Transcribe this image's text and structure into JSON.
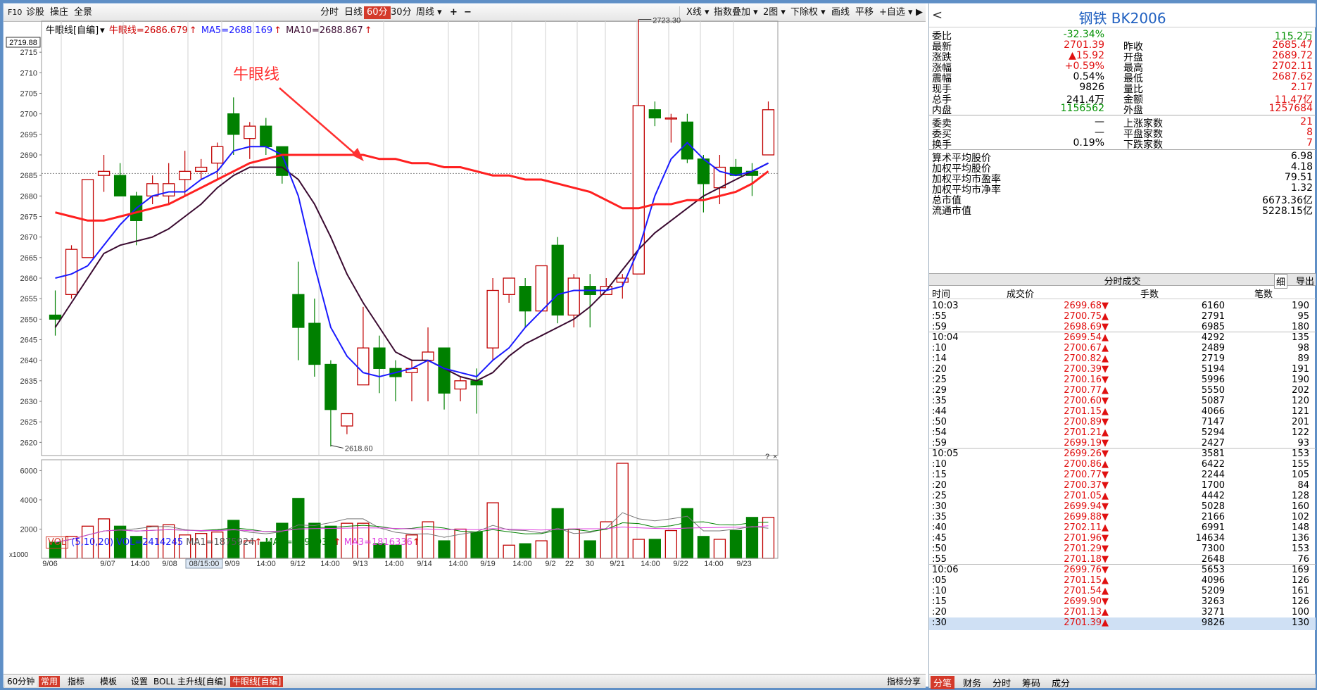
{
  "toolbar": {
    "f10": "F10",
    "diagnose": "诊股",
    "ops": "操庄",
    "full": "全景",
    "timeshare": "分时",
    "daily": "日线",
    "min60": "60分",
    "min30": "30分",
    "weekly": "周线 ▾",
    "plus": "+",
    "minus": "−",
    "xline": "X线 ▾",
    "index_overlay": "指数叠加 ▾",
    "two_chart": "2图 ▾",
    "ex_right": "下除权 ▾",
    "draw": "画线",
    "pan": "平移",
    "add_fav": "+自选 ▾",
    "next": "▶"
  },
  "info": {
    "indicator": "牛眼线[自编]",
    "mark": "▾",
    "neuyan": "牛眼线=2686.679",
    "ma5": "MA5=2688.169",
    "ma10": "MA10=2688.867",
    "arrow": "↑"
  },
  "price_axis": {
    "top_label": "2719.88",
    "ticks": [
      "2715",
      "2710",
      "2705",
      "2700",
      "2695",
      "2690",
      "2685",
      "2680",
      "2675",
      "2670",
      "2665",
      "2660",
      "2655",
      "2650",
      "2645",
      "2640",
      "2635",
      "2630",
      "2625",
      "2620"
    ]
  },
  "annotations": {
    "high": "2723.30",
    "low": "2618.60",
    "callout": "牛眼线"
  },
  "vol": {
    "name": "VOL",
    "params": "(5,10,20)",
    "vol": "VOL=2414245",
    "ma1": "MA1=1875924",
    "ma2": "MA2=2093937",
    "ma3": "MA3=1816336",
    "axis": [
      "6000",
      "4000",
      "2000"
    ],
    "unit": "x1000"
  },
  "time_labels": [
    "9/06",
    "9/07",
    "14:00",
    "9/08",
    "08/15:00",
    "9/09",
    "14:00",
    "9/12",
    "14:00",
    "9/13",
    "14:00",
    "9/14",
    "14:00",
    "9/19",
    "14:00",
    "9/2",
    "22",
    "30",
    "9/21",
    "14:00",
    "9/22",
    "14:00",
    "9/23"
  ],
  "bottom": {
    "period": "60分钟",
    "mode": "常用",
    "indicators": "指标",
    "templates": "模板",
    "settings": "设置",
    "boll": "BOLL",
    "main_up": "主升线[自编]",
    "niu": "牛眼线[自编]",
    "ind_share": "指标分享"
  },
  "colors": {
    "up": "#c00000",
    "down": "#008000",
    "neuyan": "#ff2020",
    "ma5": "#1a1aff",
    "ma10": "#3a0a30"
  },
  "chart_data": {
    "type": "candlestick",
    "ylim": [
      2618,
      2720
    ],
    "candles": [
      [
        2651,
        2657,
        2646,
        2650
      ],
      [
        2656,
        2668,
        2655,
        2667
      ],
      [
        2665,
        2684,
        2665,
        2684
      ],
      [
        2685,
        2690,
        2681,
        2686
      ],
      [
        2685,
        2688,
        2680,
        2680
      ],
      [
        2680,
        2681,
        2668,
        2674
      ],
      [
        2680,
        2685,
        2678,
        2683
      ],
      [
        2680,
        2688,
        2678,
        2683
      ],
      [
        2684,
        2691,
        2680,
        2686
      ],
      [
        2686,
        2689,
        2684,
        2687
      ],
      [
        2688,
        2693,
        2684,
        2692
      ],
      [
        2700,
        2704,
        2690,
        2695
      ],
      [
        2694,
        2698,
        2689,
        2697
      ],
      [
        2697,
        2699,
        2690,
        2692
      ],
      [
        2692,
        2692,
        2683,
        2685
      ],
      [
        2656,
        2664,
        2640,
        2648
      ],
      [
        2649,
        2655,
        2636,
        2639
      ],
      [
        2639,
        2640,
        2619,
        2628
      ],
      [
        2624,
        2627,
        2622,
        2627
      ],
      [
        2634,
        2653,
        2634,
        2643
      ],
      [
        2643,
        2646,
        2632,
        2638
      ],
      [
        2638,
        2640,
        2630,
        2636
      ],
      [
        2637,
        2640,
        2630,
        2638
      ],
      [
        2640,
        2648,
        2630,
        2642
      ],
      [
        2643,
        2643,
        2628,
        2632
      ],
      [
        2633,
        2636,
        2630,
        2635
      ],
      [
        2635,
        2638,
        2627,
        2634
      ],
      [
        2643,
        2660,
        2640,
        2657
      ],
      [
        2656,
        2660,
        2654,
        2660
      ],
      [
        2658,
        2660,
        2648,
        2652
      ],
      [
        2652,
        2663,
        2652,
        2663
      ],
      [
        2668,
        2670,
        2649,
        2651
      ],
      [
        2651,
        2661,
        2648,
        2660
      ],
      [
        2658,
        2661,
        2648,
        2656
      ],
      [
        2656,
        2660,
        2656,
        2658
      ],
      [
        2659,
        2661,
        2655,
        2660
      ],
      [
        2661,
        2723,
        2661,
        2702
      ],
      [
        2701,
        2703,
        2697,
        2699
      ],
      [
        2699,
        2700,
        2693,
        2699
      ],
      [
        2698,
        2700,
        2688,
        2689
      ],
      [
        2689,
        2690,
        2676,
        2683
      ],
      [
        2682,
        2690,
        2678,
        2687
      ],
      [
        2687,
        2689,
        2686,
        2685
      ],
      [
        2686,
        2688,
        2680,
        2685
      ],
      [
        2690,
        2703,
        2690,
        2701
      ]
    ],
    "neuyan": [
      2676,
      2675,
      2674,
      2674,
      2675,
      2676,
      2677,
      2678,
      2680,
      2682,
      2684,
      2686,
      2688,
      2689,
      2690,
      2690,
      2690,
      2690,
      2690,
      2690,
      2689,
      2689,
      2688,
      2688,
      2687,
      2687,
      2686,
      2685,
      2685,
      2684,
      2684,
      2683,
      2682,
      2681,
      2679,
      2677,
      2677,
      2678,
      2678,
      2679,
      2679,
      2680,
      2681,
      2683,
      2686
    ],
    "ma5": [
      2660,
      2661,
      2663,
      2668,
      2673,
      2677,
      2680,
      2681,
      2681,
      2684,
      2686,
      2691,
      2692,
      2692,
      2690,
      2680,
      2663,
      2648,
      2641,
      2637,
      2636,
      2637,
      2638,
      2640,
      2638,
      2637,
      2636,
      2640,
      2643,
      2648,
      2652,
      2656,
      2657,
      2657,
      2657,
      2658,
      2667,
      2680,
      2689,
      2693,
      2689,
      2686,
      2685,
      2686,
      2688
    ],
    "ma10": [
      2648,
      2654,
      2660,
      2666,
      2668,
      2669,
      2670,
      2672,
      2675,
      2678,
      2682,
      2685,
      2687,
      2687,
      2687,
      2684,
      2678,
      2670,
      2661,
      2654,
      2648,
      2642,
      2640,
      2640,
      2638,
      2636,
      2635,
      2637,
      2641,
      2644,
      2646,
      2648,
      2650,
      2653,
      2657,
      2662,
      2667,
      2671,
      2674,
      2677,
      2680,
      2682,
      2684,
      2686,
      2688
    ],
    "volume": [
      1100,
      1500,
      2200,
      2700,
      2200,
      1500,
      2200,
      2300,
      1600,
      1700,
      1800,
      2600,
      1200,
      1100,
      2400,
      4100,
      2400,
      2200,
      2400,
      2400,
      1000,
      900,
      1600,
      2500,
      1200,
      2000,
      1800,
      3800,
      900,
      1000,
      1200,
      3400,
      2000,
      1200,
      2500,
      6500,
      1300,
      1300,
      1900,
      3400,
      1500,
      1300,
      1900,
      2800,
      2800
    ]
  },
  "panel": {
    "title": "钢铁  BK2006",
    "back": "<",
    "rows": [
      [
        "委比",
        "-32.34%",
        "",
        "115.2万"
      ],
      [
        "最新",
        "2701.39",
        "昨收",
        "2685.47"
      ],
      [
        "涨跌",
        "▲15.92",
        "开盘",
        "2689.72"
      ],
      [
        "涨幅",
        "+0.59%",
        "最高",
        "2702.11"
      ],
      [
        "震幅",
        "0.54%",
        "最低",
        "2687.62"
      ],
      [
        "现手",
        "9826",
        "量比",
        "2.17"
      ],
      [
        "总手",
        "241.4万",
        "金额",
        "11.47亿"
      ],
      [
        "内盘",
        "1156562",
        "外盘",
        "1257684"
      ],
      [
        "委卖",
        "—",
        "上涨家数",
        "21"
      ],
      [
        "委买",
        "—",
        "平盘家数",
        "8"
      ],
      [
        "换手",
        "0.19%",
        "下跌家数",
        "7"
      ]
    ],
    "stats": [
      [
        "算术平均股价",
        "6.98"
      ],
      [
        "加权平均股价",
        "4.18"
      ],
      [
        "加权平均市盈率",
        "79.51"
      ],
      [
        "加权平均市净率",
        "1.32"
      ],
      [
        "总市值",
        "6673.36亿"
      ],
      [
        "流通市值",
        "5228.15亿"
      ]
    ],
    "trade_title": "分时成交",
    "fine": "细",
    "export": "导出",
    "cols": [
      "时间",
      "成交价",
      "手数",
      "笔数"
    ],
    "trades": [
      [
        "10:03",
        "2699.68▼",
        "6160",
        "190"
      ],
      [
        ":55",
        "2700.75▲",
        "2791",
        "95"
      ],
      [
        ":59",
        "2698.69▼",
        "6985",
        "180"
      ],
      [
        "10:04",
        "2699.54▲",
        "4292",
        "135"
      ],
      [
        ":10",
        "2700.67▲",
        "2489",
        "98"
      ],
      [
        ":14",
        "2700.82▲",
        "2719",
        "89"
      ],
      [
        ":20",
        "2700.39▼",
        "5194",
        "191"
      ],
      [
        ":25",
        "2700.16▼",
        "5996",
        "190"
      ],
      [
        ":29",
        "2700.77▲",
        "5550",
        "202"
      ],
      [
        ":35",
        "2700.60▼",
        "5087",
        "120"
      ],
      [
        ":44",
        "2701.15▲",
        "4066",
        "121"
      ],
      [
        ":50",
        "2700.89▼",
        "7147",
        "201"
      ],
      [
        ":54",
        "2701.21▲",
        "5294",
        "122"
      ],
      [
        ":59",
        "2699.19▼",
        "2427",
        "93"
      ],
      [
        "10:05",
        "2699.26▼",
        "3581",
        "153"
      ],
      [
        ":10",
        "2700.86▲",
        "6422",
        "155"
      ],
      [
        ":15",
        "2700.77▼",
        "2244",
        "105"
      ],
      [
        ":20",
        "2700.37▼",
        "1700",
        "84"
      ],
      [
        ":25",
        "2701.05▲",
        "4442",
        "128"
      ],
      [
        ":30",
        "2699.94▼",
        "5028",
        "160"
      ],
      [
        ":35",
        "2699.88▼",
        "2166",
        "102"
      ],
      [
        ":40",
        "2702.11▲",
        "6991",
        "148"
      ],
      [
        ":45",
        "2701.96▼",
        "14634",
        "136"
      ],
      [
        ":50",
        "2701.29▼",
        "7300",
        "153"
      ],
      [
        ":55",
        "2701.18▼",
        "2648",
        "76"
      ],
      [
        "10:06",
        "2699.76▼",
        "5653",
        "169"
      ],
      [
        ":05",
        "2701.15▲",
        "4096",
        "126"
      ],
      [
        ":10",
        "2701.54▲",
        "5209",
        "161"
      ],
      [
        ":15",
        "2699.90▼",
        "3263",
        "126"
      ],
      [
        ":20",
        "2701.13▲",
        "3271",
        "100"
      ],
      [
        ":30",
        "2701.39▲",
        "9826",
        "130"
      ]
    ],
    "tabs": [
      "分笔",
      "财务",
      "分时",
      "筹码",
      "成分"
    ]
  }
}
